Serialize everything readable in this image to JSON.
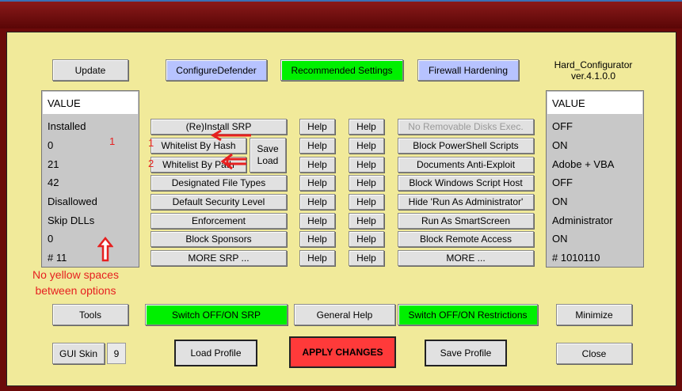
{
  "top_buttons": {
    "update": "Update",
    "configure_defender": "ConfigureDefender",
    "recommended_settings": "Recommended Settings",
    "firewall_hardening": "Firewall Hardening"
  },
  "app": {
    "name": "Hard_Configurator",
    "version": "ver.4.1.0.0"
  },
  "left_panel": {
    "header": "VALUE",
    "values": [
      "Installed",
      "0",
      "21",
      "42",
      "Disallowed",
      "Skip DLLs",
      "0",
      "# 11"
    ]
  },
  "right_panel": {
    "header": "VALUE",
    "values": [
      "OFF",
      "ON",
      "Adobe + VBA",
      "OFF",
      "ON",
      "Administrator",
      "ON",
      "# 1010110"
    ]
  },
  "srp": {
    "reinstall": "(Re)Install SRP",
    "whitelist_hash": "Whitelist By Hash",
    "whitelist_path": "Whitelist By Path",
    "save_load_save": "Save",
    "save_load_load": "Load",
    "designated_file_types": "Designated File Types",
    "default_security_level": "Default Security Level",
    "enforcement": "Enforcement",
    "block_sponsors": "Block Sponsors",
    "more_srp": "MORE SRP ..."
  },
  "help_label": "Help",
  "restrictions": [
    "No Removable Disks Exec.",
    "Block PowerShell Scripts",
    "Documents Anti-Exploit",
    "Block Windows Script Host",
    "Hide  'Run As Administrator'",
    "Run As SmartScreen",
    "Block Remote Access",
    "MORE ..."
  ],
  "annotations": {
    "num1_right": "1",
    "num1_left": "1",
    "num2_left": "2",
    "note_line1": "No yellow spaces",
    "note_line2": "between options"
  },
  "bottom_buttons": {
    "tools": "Tools",
    "switch_srp": "Switch OFF/ON SRP",
    "general_help": "General Help",
    "switch_restrictions": "Switch OFF/ON Restrictions",
    "minimize": "Minimize",
    "gui_skin": "GUI Skin",
    "gui_skin_value": "9",
    "load_profile": "Load Profile",
    "apply_changes": "APPLY CHANGES",
    "save_profile": "Save Profile",
    "close": "Close"
  },
  "colors": {
    "background": "#f1ea9a",
    "green": "#00f000",
    "blue": "#b7c3ff",
    "red": "#ff3a3a",
    "annotation": "#e62020"
  }
}
